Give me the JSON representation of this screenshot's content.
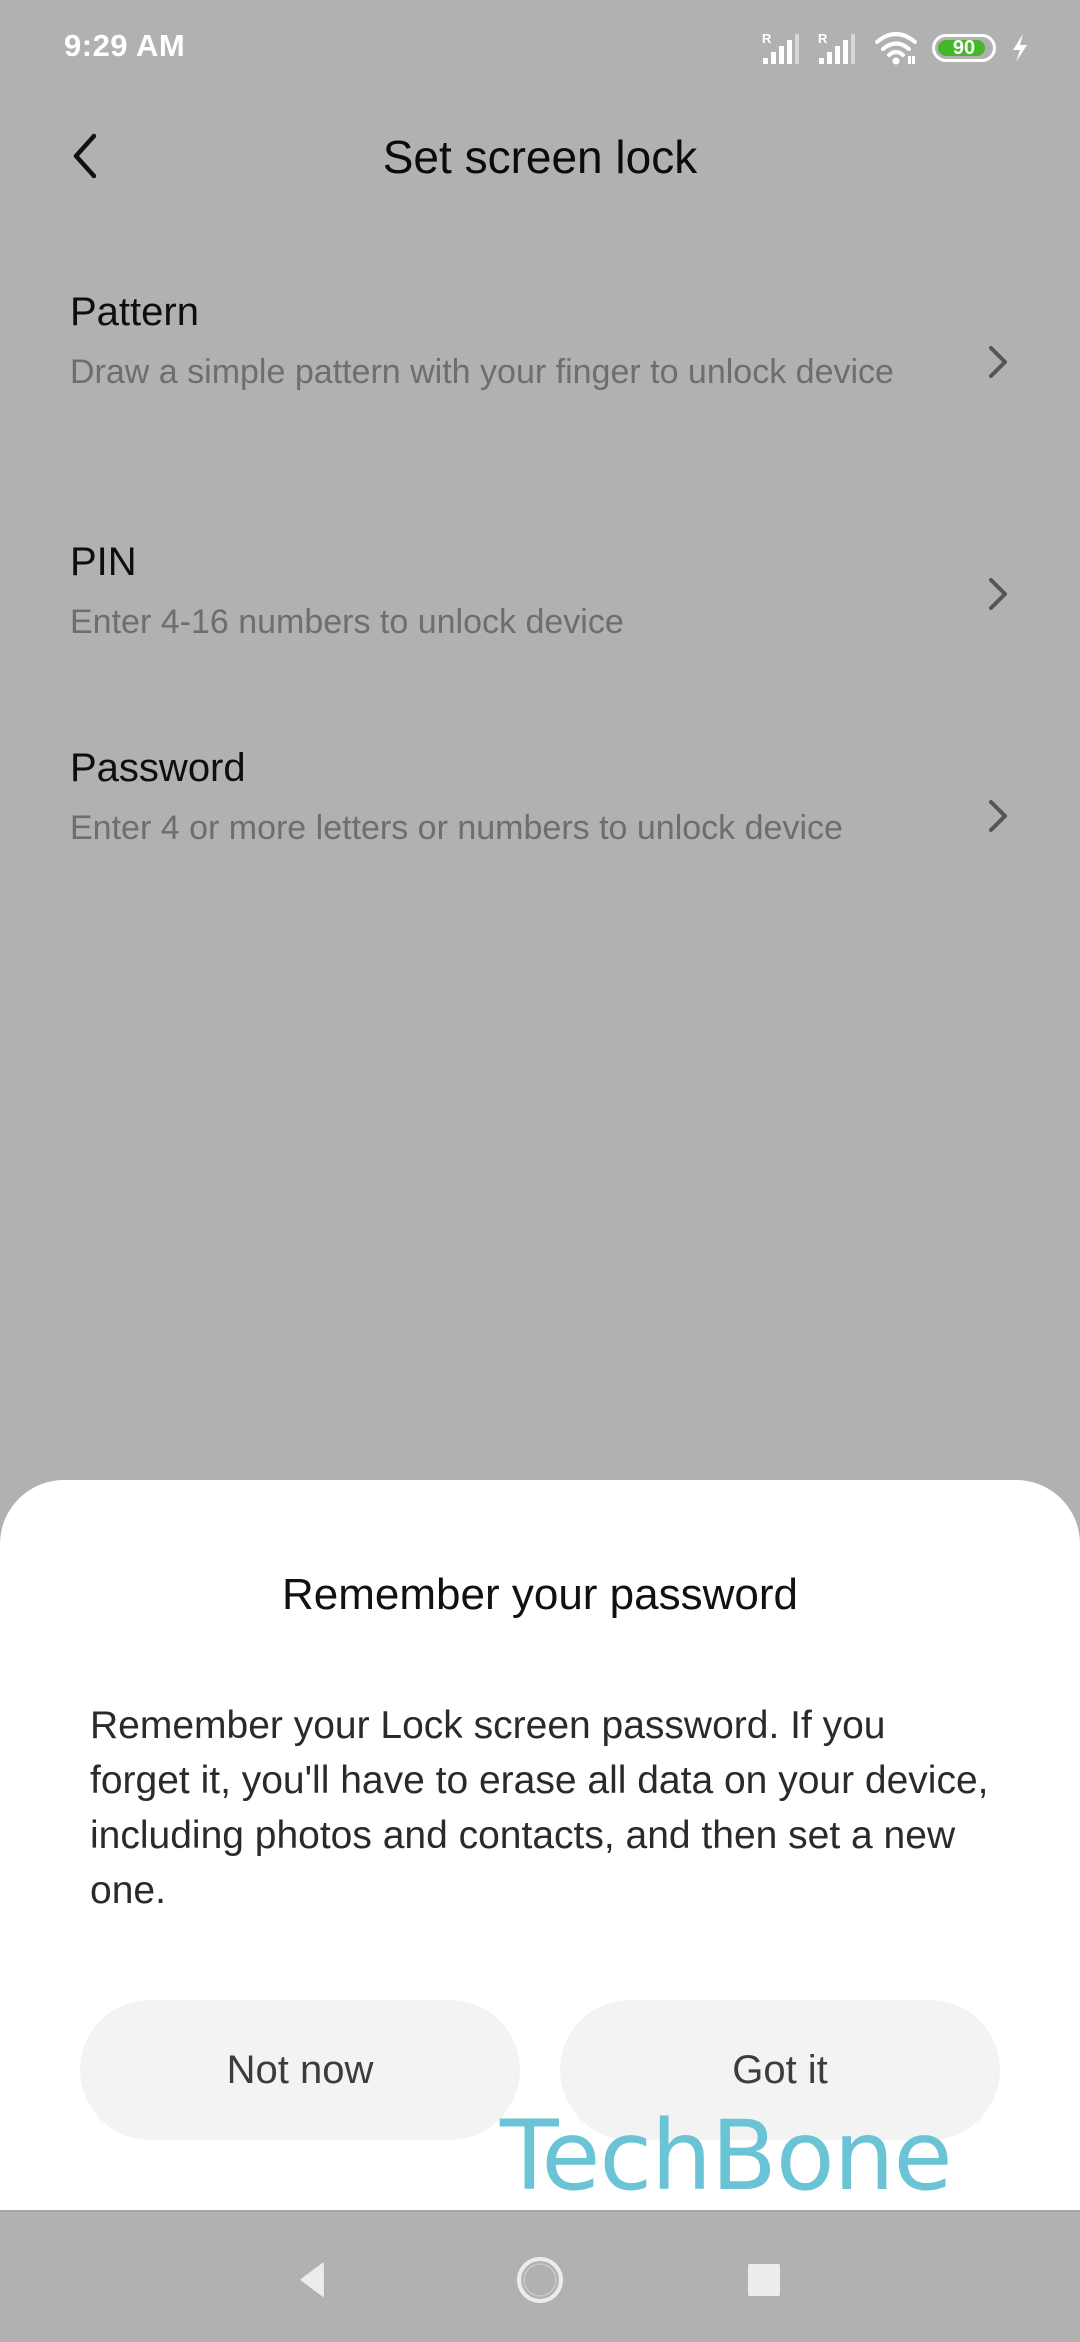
{
  "status_bar": {
    "time": "9:29 AM",
    "signal1_label": "R",
    "signal2_label": "R",
    "battery_level": "90",
    "charging": true,
    "battery_color": "#45b52a"
  },
  "header": {
    "title": "Set screen lock"
  },
  "options": [
    {
      "title": "Pattern",
      "description": "Draw a simple pattern with your finger to unlock device"
    },
    {
      "title": "PIN",
      "description": "Enter 4-16 numbers to unlock device"
    },
    {
      "title": "Password",
      "description": "Enter 4 or more letters or numbers to unlock device"
    }
  ],
  "dialog": {
    "title": "Remember your password",
    "body": "Remember your Lock screen password. If you forget it, you'll have to erase all data on your device, including photos and contacts, and then set a new one.",
    "buttons": {
      "secondary": "Not now",
      "primary": "Got it"
    }
  },
  "watermark": {
    "text": "TechBone",
    "color": "#6bc3d6"
  },
  "nav_bar": {
    "icons": [
      "back-triangle-icon",
      "home-circle-icon",
      "recents-square-icon"
    ]
  }
}
